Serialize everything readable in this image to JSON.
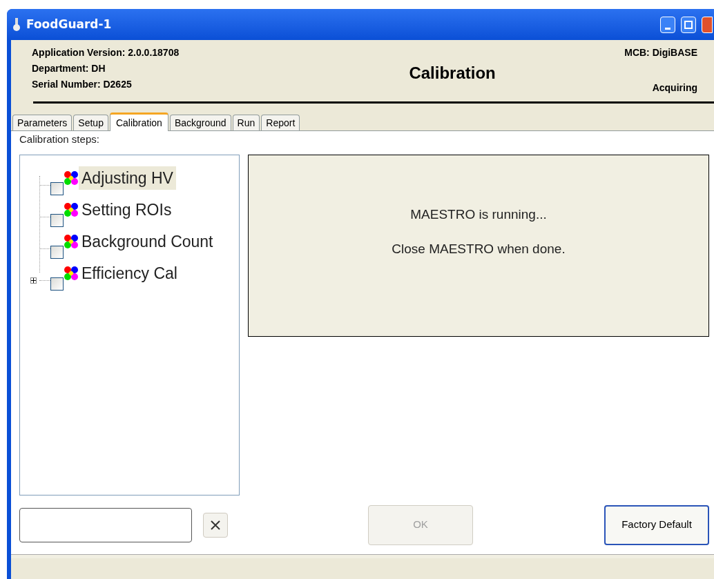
{
  "window": {
    "title": "FoodGuard-1"
  },
  "header": {
    "info_lines": [
      "Application Version: 2.0.0.18708",
      "Department: DH",
      "Serial Number: D2625"
    ],
    "title": "Calibration",
    "mcb": "MCB: DigiBASE",
    "status": "Acquiring"
  },
  "tabs": [
    {
      "label": "Parameters",
      "selected": false
    },
    {
      "label": "Setup",
      "selected": false
    },
    {
      "label": "Calibration",
      "selected": true
    },
    {
      "label": "Background",
      "selected": false
    },
    {
      "label": "Run",
      "selected": false
    },
    {
      "label": "Report",
      "selected": false
    }
  ],
  "steps_label": "Calibration steps:",
  "tree": [
    {
      "label": "Adjusting HV",
      "checked": false,
      "selected": true,
      "has_children": false
    },
    {
      "label": "Setting ROIs",
      "checked": false,
      "selected": false,
      "has_children": false
    },
    {
      "label": "Background Count",
      "checked": false,
      "selected": false,
      "has_children": false
    },
    {
      "label": "Efficiency Cal",
      "checked": false,
      "selected": false,
      "has_children": true,
      "expanded": false
    }
  ],
  "message": [
    "MAESTRO is running...",
    "Close MAESTRO when done."
  ],
  "buttons": [
    {
      "label": "OK",
      "disabled": true
    },
    {
      "label": "Factory Default",
      "disabled": false
    }
  ]
}
